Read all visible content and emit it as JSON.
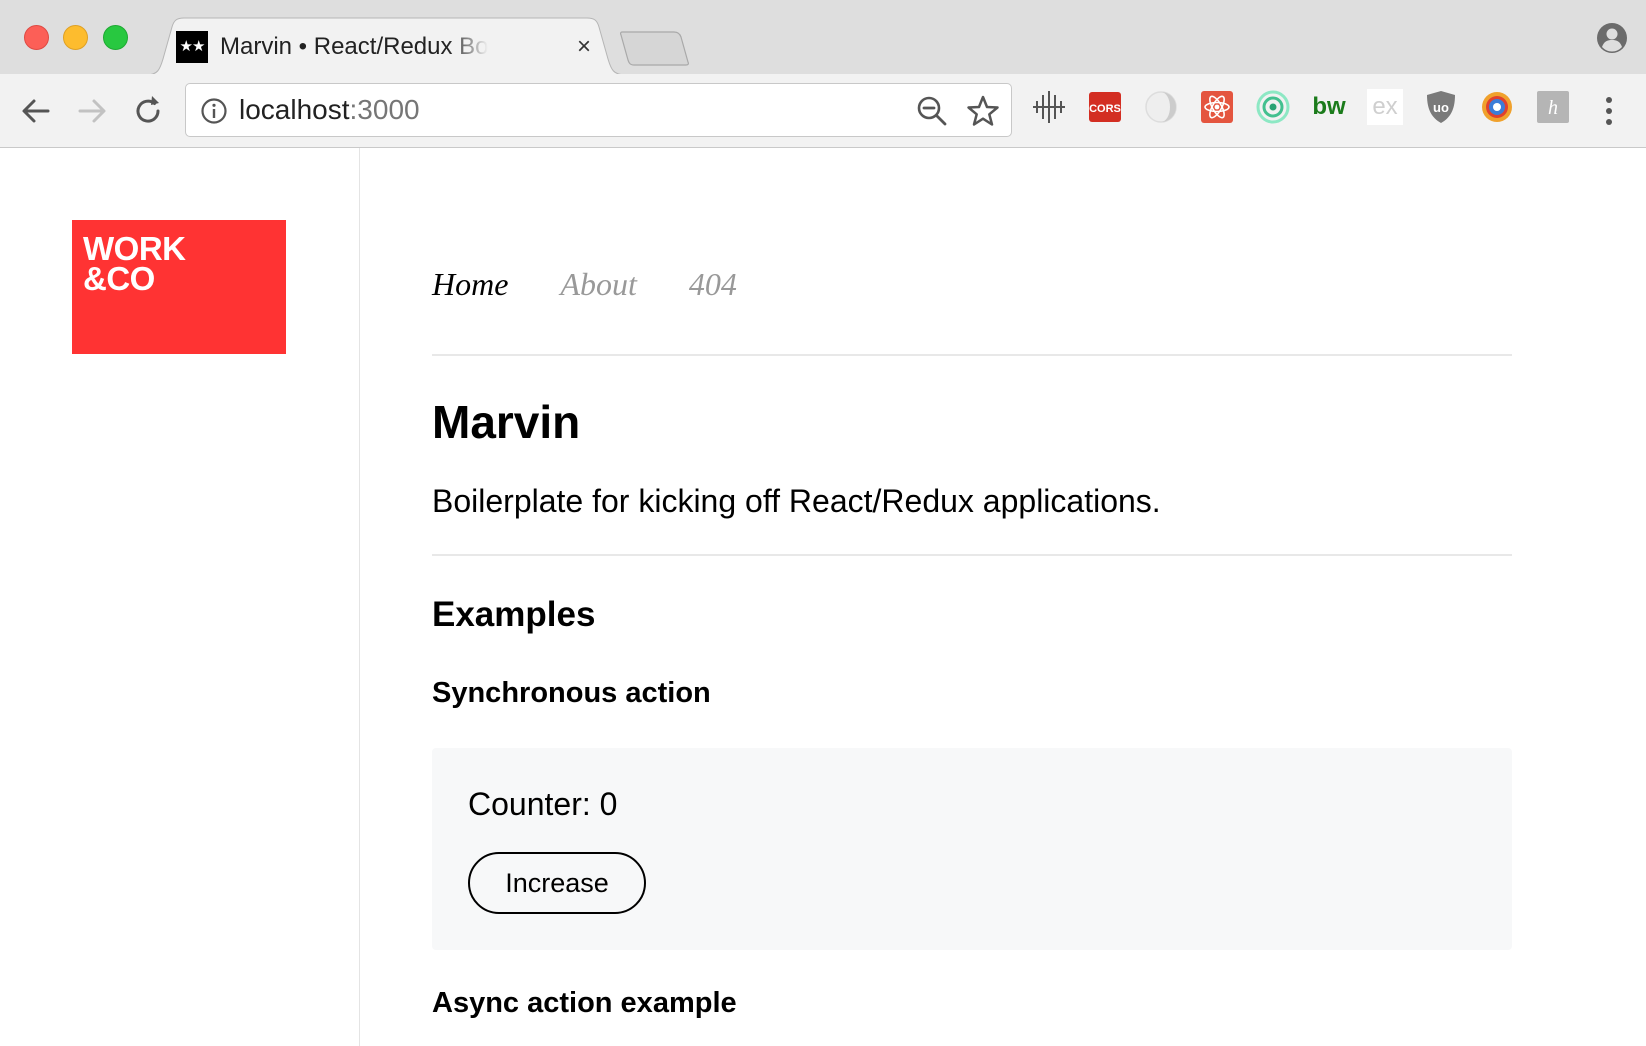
{
  "browser": {
    "tab": {
      "favicon": "★★",
      "title": "Marvin • React/Redux Boilerplate",
      "close": "×"
    },
    "address": {
      "host": "localhost",
      "port": ":3000"
    },
    "extensions": [
      {
        "name": "move-icon"
      },
      {
        "name": "cors-extension-icon",
        "label": "CORS"
      },
      {
        "name": "dark-circle-extension-icon"
      },
      {
        "name": "react-devtools-icon"
      },
      {
        "name": "target-extension-icon"
      },
      {
        "name": "bw-extension-icon",
        "label": "bw"
      },
      {
        "name": "ex-extension-icon",
        "label": "ex"
      },
      {
        "name": "ublock-icon",
        "label": "uo"
      },
      {
        "name": "colorful-circle-extension-icon"
      },
      {
        "name": "hypothesis-icon",
        "label": "h"
      }
    ]
  },
  "sidebar": {
    "logo_text": "WORK\n&CO",
    "logo_color": "#ff3333"
  },
  "nav": {
    "items": [
      {
        "label": "Home",
        "active": true
      },
      {
        "label": "About",
        "active": false
      },
      {
        "label": "404",
        "active": false
      }
    ]
  },
  "main": {
    "title": "Marvin",
    "description": "Boilerplate for kicking off React/Redux applications.",
    "examples_heading": "Examples",
    "sync_heading": "Synchronous action",
    "counter_label": "Counter: 0",
    "increase_label": "Increase",
    "async_heading": "Async action example"
  }
}
